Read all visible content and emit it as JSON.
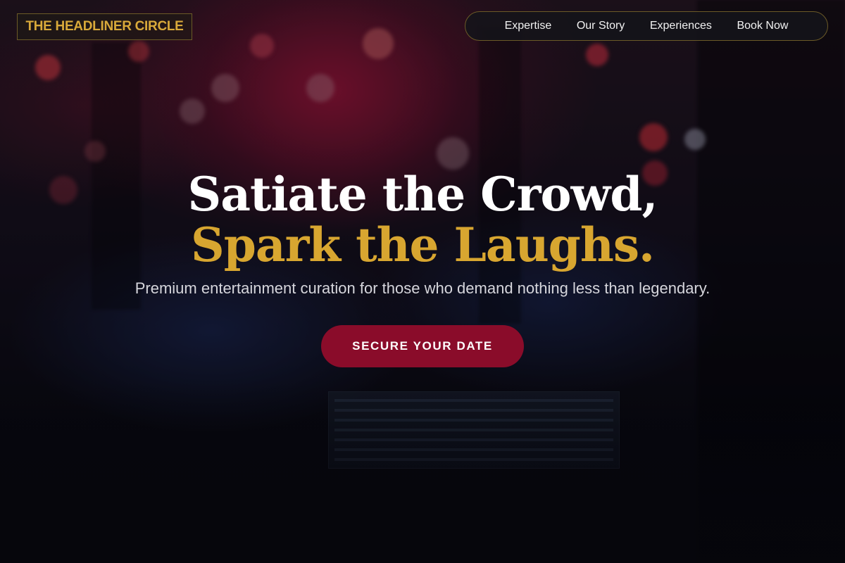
{
  "brand": {
    "logo_text": "THE HEADLINER CIRCLE",
    "accent_color": "#d8a630",
    "cta_color": "#8a0c2a"
  },
  "nav": {
    "items": [
      {
        "label": "Expertise"
      },
      {
        "label": "Our Story"
      },
      {
        "label": "Experiences"
      },
      {
        "label": "Book Now"
      }
    ]
  },
  "hero": {
    "headline_line1": "Satiate the Crowd,",
    "headline_line2": "Spark the Laughs.",
    "subtitle": "Premium entertainment curation for those who demand nothing less than legendary.",
    "cta_label": "SECURE YOUR DATE"
  }
}
